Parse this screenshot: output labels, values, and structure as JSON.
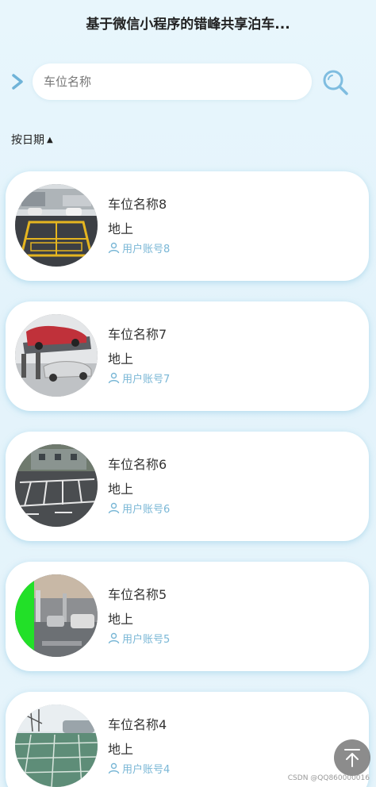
{
  "header": {
    "title": "基于微信小程序的错峰共享泊车..."
  },
  "search": {
    "placeholder": "车位名称",
    "value": ""
  },
  "sort": {
    "label": "按日期",
    "indicator": "▲"
  },
  "items": [
    {
      "name": "车位名称8",
      "location": "地上",
      "user": "用户账号8",
      "image": "parking-lot-yellow-markings"
    },
    {
      "name": "车位名称7",
      "location": "地上",
      "user": "用户账号7",
      "image": "car-lift-parking"
    },
    {
      "name": "车位名称6",
      "location": "地上",
      "user": "用户账号6",
      "image": "outdoor-parking-spaces"
    },
    {
      "name": "车位名称5",
      "location": "地上",
      "user": "用户账号5",
      "image": "underground-garage"
    },
    {
      "name": "车位名称4",
      "location": "地上",
      "user": "用户账号4",
      "image": "green-paved-parking"
    }
  ],
  "watermark": "CSDN @QQ860000016",
  "colors": {
    "accent": "#7ab7d6",
    "background": "#e6f4fb"
  }
}
